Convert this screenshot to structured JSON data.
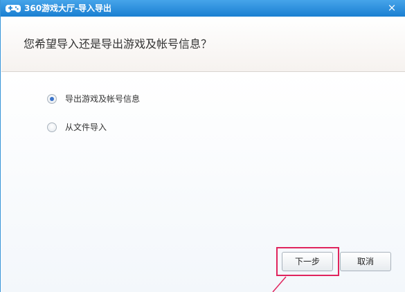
{
  "window": {
    "title": "360游戏大厅-导入导出",
    "close_glyph": "×"
  },
  "header": {
    "question": "您希望导入还是导出游戏及帐号信息？"
  },
  "options": [
    {
      "label": "导出游戏及帐号信息",
      "selected": true
    },
    {
      "label": "从文件导入",
      "selected": false
    }
  ],
  "buttons": {
    "next": "下一步",
    "cancel": "取消"
  },
  "annotation": {
    "highlight_color": "#e0245d"
  },
  "colors": {
    "titlebar": "#1f86d6",
    "radio_selected": "#3b73c9"
  },
  "icons": {
    "app": "gamepad-icon",
    "close": "close-icon"
  }
}
